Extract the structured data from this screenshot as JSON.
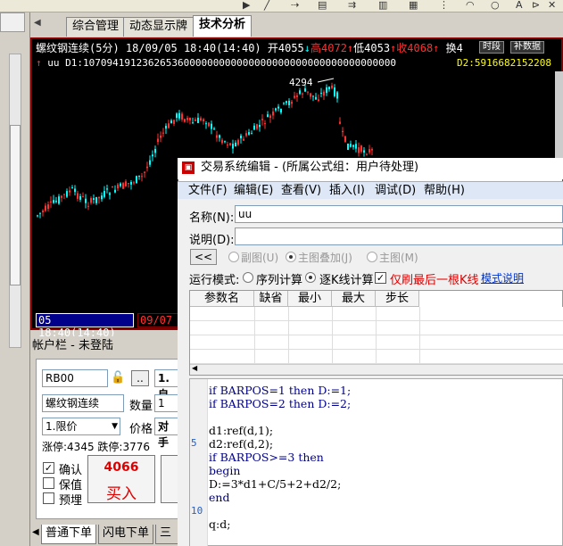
{
  "tabs": {
    "t1": "综合管理",
    "t2": "动态显示牌",
    "t3": "技术分析"
  },
  "chart": {
    "title_name": "螺纹钢连续(5分)",
    "title_date": "18/09/05 18:40(14:40)",
    "open_label": "开4055",
    "high_label": "高4072",
    "low_label": "低4053",
    "close_label": "收4068",
    "vol_label": "换4",
    "btn_time": "时段",
    "btn_supp": "补数据",
    "indicator_name": "uu",
    "indicator_d1": "D1:10709419123626536000000000000000000000000000000000000",
    "indicator_d2": "D2:5916682152208",
    "peak_label": "4294",
    "time_bar": "05 18:40(14:40)",
    "time_bar2": "09/07",
    "up_color": "#ff3030",
    "down_color": "#00ffff"
  },
  "account": {
    "header": "帐户栏 - 未登陆",
    "contract": "RB00",
    "btn_dots": "..",
    "side_val": "1.自",
    "name": "螺纹钢连续",
    "qty_label": "数量",
    "qty_val": "1",
    "order_type": "1.限价",
    "price_label": "价格",
    "price_val": "对手",
    "limits": "涨停:4345 跌停:3776",
    "confirm_label": "确认",
    "keep_label": "保值",
    "preorder_label": "预埋",
    "buy_price": "4066",
    "buy_label": "买入"
  },
  "bottom_tabs": {
    "b1": "普通下单",
    "b2": "闪电下单",
    "b3": "三键"
  },
  "dialog": {
    "title": "交易系统编辑 - (所属公式组：用户待处理)",
    "menu": {
      "m1": "文件(F)",
      "m2": "编辑(E)",
      "m3": "查看(V)",
      "m4": "插入(I)",
      "m5": "调试(D)",
      "m6": "帮助(H)"
    },
    "name_label": "名称(N):",
    "name_value": "uu",
    "desc_label": "说明(D):",
    "desc_value": "",
    "back_btn": "<<",
    "sub_label": "副图(U)",
    "main_overlay_label": "主图叠加(J)",
    "main_label": "主图(M)",
    "mode_label": "运行模式:",
    "seq_label": "序列计算",
    "bar_label": "逐K线计算",
    "refresh_label": "仅刷最后一根K线",
    "help_link": "模式说明",
    "param_headers": {
      "h1": "参数名",
      "h2": "缺省",
      "h3": "最小",
      "h4": "最大",
      "h5": "步长"
    },
    "code": {
      "l1": "if BARPOS=1 then D:=1;",
      "l2": "if BARPOS=2 then D:=2;",
      "l3": "",
      "l4": "d1:ref(d,1);",
      "l5": "d2:ref(d,2);",
      "l6": "if BARPOS>=3 then",
      "l7": "begin",
      "l8": "D:=3*d1+C/5+2+d2/2;",
      "l9": "end",
      "l10": "",
      "l11": "q:d;"
    },
    "line_numbers": {
      "n5": "5",
      "n10": "10"
    }
  }
}
